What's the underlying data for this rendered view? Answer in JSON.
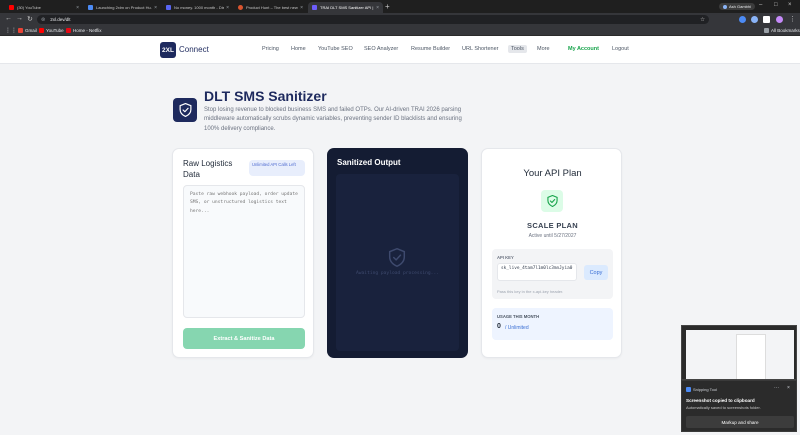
{
  "browser": {
    "tabs": [
      {
        "title": "(30) YouTube",
        "color": "#ff0000",
        "active": false
      },
      {
        "title": "Launching 2xlm on Product Hu...",
        "color": "#4c8bf5",
        "active": false
      },
      {
        "title": "No money. 1000 month - Disco...",
        "color": "#5865f2",
        "active": false
      },
      {
        "title": "Product Hunt – The best new p...",
        "color": "#da552f",
        "active": false
      },
      {
        "title": "TRAI DLT SMS Sanitizer API | 2...",
        "color": "#1e2a5e",
        "active": true
      }
    ],
    "new_tab": "+",
    "account_chip": "Ash Gambhi",
    "url": "2xl.dev/dlt",
    "bookmarks": [
      {
        "label": "Gmail",
        "color": "#ea4335"
      },
      {
        "label": "YouTube",
        "color": "#ff0000"
      },
      {
        "label": "Home - Netflix",
        "color": "#e50914"
      }
    ],
    "all_bookmarks": "All Bookmarks"
  },
  "site": {
    "logo_mark": "2XL",
    "logo_text": "Connect",
    "nav": [
      "Pricing",
      "Home",
      "YouTube SEO",
      "SEO Analyzer",
      "Resume Builder",
      "URL Shortener",
      "Tools",
      "More"
    ],
    "my_account": "My Account",
    "logout": "Logout"
  },
  "hero": {
    "title": "DLT SMS Sanitizer",
    "subtitle": "Stop losing revenue to blocked business SMS and failed OTPs. Our AI-driven TRAI 2026 parsing middleware automatically scrubs dynamic variables, preventing sender ID blacklists and ensuring 100% delivery compliance."
  },
  "raw": {
    "title": "Raw Logistics Data",
    "badge": "Unlimited API Calls Left",
    "placeholder": "Paste raw webhook payload, order update SMS, or unstructured logistics text here...",
    "button": "Extract & Sanitize Data"
  },
  "output": {
    "title": "Sanitized Output",
    "waiting": "Awaiting payload processing..."
  },
  "plan": {
    "title": "Your API Plan",
    "name": "SCALE PLAN",
    "active_until": "Active until 5/27/2027",
    "api_key_label": "API KEY",
    "api_key": "sk_live_4tam7l1m0lc3mnJyia0",
    "copy": "Copy",
    "key_hint": "Pass this key in the x-api-key header.",
    "usage_label": "USAGE THIS MONTH",
    "usage_value": "0",
    "usage_limit": "/ Unlimited"
  },
  "snip": {
    "app": "Snipping Tool",
    "heading": "Screenshot copied to clipboard",
    "body": "Automatically saved to screenshots folder.",
    "button": "Markup and share"
  },
  "colors": {
    "brand": "#1e2a5e",
    "accent_green": "#16a34a",
    "dark_panel": "#141c33"
  }
}
